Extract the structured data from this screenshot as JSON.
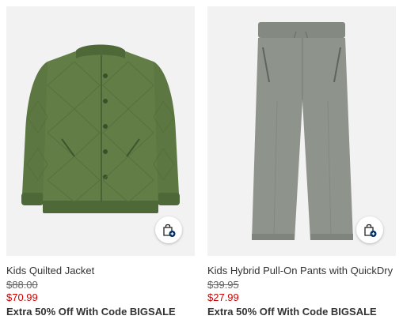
{
  "products": [
    {
      "name": "Kids Quilted Jacket",
      "original_price": "$88.00",
      "sale_price": "$70.99",
      "promo": "Extra 50% Off With Code BIGSALE",
      "image_icon": "quilted-jacket-image",
      "color": "#5e7a43"
    },
    {
      "name": "Kids Hybrid Pull-On Pants with QuickDry",
      "original_price": "$39.95",
      "sale_price": "$27.99",
      "promo": "Extra 50% Off With Code BIGSALE",
      "image_icon": "pull-on-pants-image",
      "color": "#8e948b"
    }
  ],
  "colors": {
    "image_background": "#f2f2f2",
    "sale_price": "#d00000",
    "text": "#333333",
    "bag_button_badge": "#002f5f"
  },
  "icons": {
    "add_to_bag": "shopping-bag-plus-icon"
  }
}
